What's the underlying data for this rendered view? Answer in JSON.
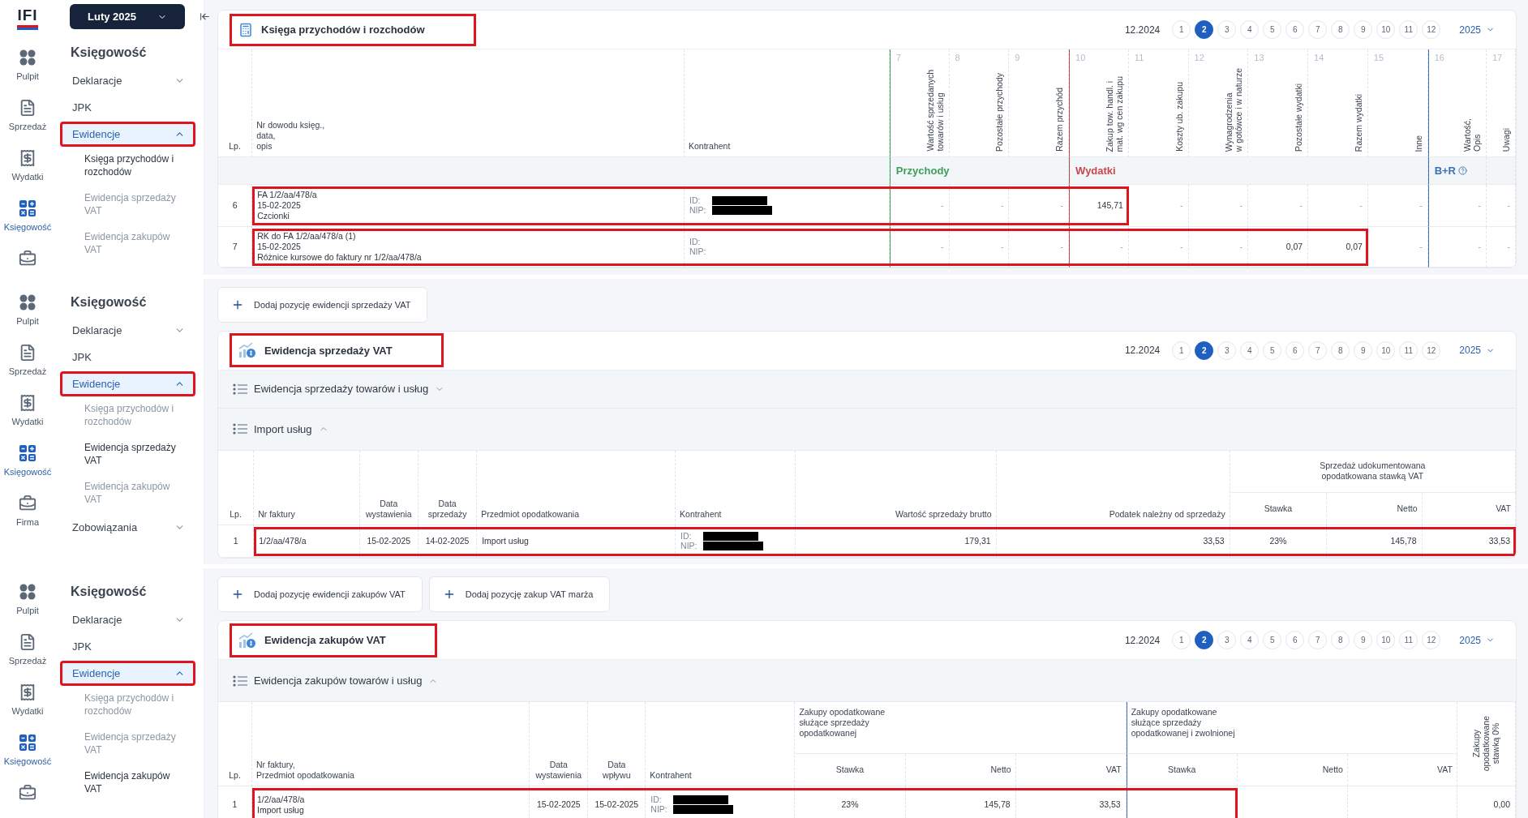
{
  "panels": [
    {
      "kind": "kpir",
      "logo": "IFI",
      "period_button": "Luty 2025",
      "rail": [
        {
          "kind": "dashboard",
          "label": "Pulpit",
          "selected": false
        },
        {
          "kind": "sales",
          "label": "Sprzedaż",
          "selected": false
        },
        {
          "kind": "expenses",
          "label": "Wydatki",
          "selected": false
        },
        {
          "kind": "accounting",
          "label": "Księgowość",
          "selected": true
        },
        {
          "kind": "company",
          "selected": false
        }
      ],
      "nav": {
        "heading": "Księgowość",
        "items": [
          {
            "label": "Deklaracje",
            "kind": "group",
            "expanded": false,
            "selected": false,
            "highlighted": false
          },
          {
            "label": "JPK",
            "kind": "link",
            "selected": false,
            "highlighted": false
          },
          {
            "label": "Ewidencje",
            "kind": "group",
            "expanded": true,
            "selected": true,
            "highlighted": true,
            "children": [
              {
                "label": "Księga przychodów i rozchodów",
                "selected": true
              },
              {
                "label": "Ewidencja sprzedaży VAT",
                "selected": false
              },
              {
                "label": "Ewidencja zakupów VAT",
                "selected": false
              }
            ]
          }
        ]
      },
      "card": {
        "title": "Księga przychodów i rozchodów",
        "title_highlighted": true,
        "pager": {
          "period": "12.2024",
          "months": [
            {
              "label": "1",
              "selected": false
            },
            {
              "label": "2",
              "selected": true
            },
            {
              "label": "3",
              "selected": false
            },
            {
              "label": "4",
              "selected": false
            },
            {
              "label": "5",
              "selected": false
            },
            {
              "label": "6",
              "selected": false
            },
            {
              "label": "7",
              "selected": false
            },
            {
              "label": "8",
              "selected": false
            },
            {
              "label": "9",
              "selected": false
            },
            {
              "label": "10",
              "selected": false
            },
            {
              "label": "11",
              "selected": false
            },
            {
              "label": "12",
              "selected": false
            }
          ],
          "year": "2025"
        },
        "table": {
          "kind": "kpir",
          "columns": [
            {
              "lines": [
                "Lp."
              ]
            },
            {
              "lines": [
                "Nr dowodu księg.,",
                "data,",
                "opis"
              ]
            },
            {
              "lines": [
                "Kontrahent"
              ]
            }
          ],
          "column_groups": [
            {
              "label": "Przychody",
              "color": "#3f9d5a",
              "columns": [
                {
                  "number": "7",
                  "lines": [
                    "Wartość sprzedanych",
                    "towarów i usług"
                  ]
                },
                {
                  "number": "8",
                  "lines": [
                    "Pozostałe przychody"
                  ]
                },
                {
                  "number": "9",
                  "lines": [
                    "Razem przychód"
                  ]
                }
              ]
            },
            {
              "label": "Wydatki",
              "color": "#c5484b",
              "columns": [
                {
                  "number": "10",
                  "lines": [
                    "Zakup tow. handl. i",
                    "mat. wg cen zakupu"
                  ]
                },
                {
                  "number": "11",
                  "lines": [
                    "Koszty ub. zakupu"
                  ]
                },
                {
                  "number": "12",
                  "lines": [
                    "Wynagrodzenia",
                    "w gotówce i w naturze"
                  ]
                },
                {
                  "number": "13",
                  "lines": [
                    "Pozostałe wydatki"
                  ]
                },
                {
                  "number": "14",
                  "lines": [
                    "Razem wydatki"
                  ]
                },
                {
                  "number": "15",
                  "lines": [
                    "Inne"
                  ]
                }
              ]
            },
            {
              "label": "B+R",
              "color": "#3b6fb6",
              "help": true,
              "columns": [
                {
                  "number": "16",
                  "lines": [
                    "Wartość,",
                    "Opis"
                  ]
                }
              ]
            },
            {
              "columns": [
                {
                  "number": "17",
                  "lines": [
                    "Uwagi"
                  ]
                }
              ]
            }
          ],
          "rows": [
            {
              "lead_cells": [
                {
                  "kind": "text",
                  "lines": [
                    "6"
                  ]
                }
              ],
              "framed_cells": [
                {
                  "kind": "text",
                  "lines": [
                    "FA 1/2/aa/478/a",
                    "15-02-2025",
                    "Czcionki"
                  ]
                },
                {
                  "kind": "contractor",
                  "id_label": "ID:",
                  "nip_label": "NIP:",
                  "redacted": true
                },
                {
                  "kind": "dash",
                  "lines": [
                    "-"
                  ]
                },
                {
                  "kind": "dash",
                  "lines": [
                    "-"
                  ]
                },
                {
                  "kind": "dash",
                  "lines": [
                    "-"
                  ]
                },
                {
                  "kind": "text",
                  "lines": [
                    "145,71"
                  ]
                }
              ],
              "trail_cells": [
                {
                  "kind": "dash",
                  "lines": [
                    "-"
                  ]
                },
                {
                  "kind": "dash",
                  "lines": [
                    "-"
                  ]
                },
                {
                  "kind": "dash",
                  "lines": [
                    "-"
                  ]
                },
                {
                  "kind": "dash",
                  "lines": [
                    "-"
                  ]
                },
                {
                  "kind": "dash",
                  "lines": [
                    "-"
                  ]
                },
                {
                  "kind": "dash",
                  "lines": [
                    "-"
                  ]
                },
                {
                  "kind": "dash",
                  "lines": [
                    "-"
                  ]
                }
              ]
            },
            {
              "lead_cells": [
                {
                  "kind": "text",
                  "lines": [
                    "7"
                  ]
                }
              ],
              "framed_cells": [
                {
                  "kind": "text",
                  "lines": [
                    "RK do FA 1/2/aa/478/a (1)",
                    "15-02-2025",
                    "Różnice kursowe do faktury nr 1/2/aa/478/a"
                  ]
                },
                {
                  "kind": "contractor",
                  "id_label": "ID:",
                  "nip_label": "NIP:",
                  "redacted": false
                },
                {
                  "kind": "dash",
                  "lines": [
                    "-"
                  ]
                },
                {
                  "kind": "dash",
                  "lines": [
                    "-"
                  ]
                },
                {
                  "kind": "dash",
                  "lines": [
                    "-"
                  ]
                },
                {
                  "kind": "dash",
                  "lines": [
                    "-"
                  ]
                },
                {
                  "kind": "dash",
                  "lines": [
                    "-"
                  ]
                },
                {
                  "kind": "dash",
                  "lines": [
                    "-"
                  ]
                },
                {
                  "kind": "text",
                  "lines": [
                    "0,07"
                  ]
                },
                {
                  "kind": "text",
                  "lines": [
                    "0,07"
                  ]
                }
              ],
              "trail_cells": [
                {
                  "kind": "dash",
                  "lines": [
                    "-"
                  ]
                },
                {
                  "kind": "dash",
                  "lines": [
                    "-"
                  ]
                },
                {
                  "kind": "dash",
                  "lines": [
                    "-"
                  ]
                }
              ]
            }
          ]
        }
      }
    },
    {
      "kind": "sales",
      "rail": [
        {
          "kind": "dashboard",
          "label": "Pulpit",
          "selected": false
        },
        {
          "kind": "sales",
          "label": "Sprzedaż",
          "selected": false
        },
        {
          "kind": "expenses",
          "label": "Wydatki",
          "selected": false
        },
        {
          "kind": "accounting",
          "label": "Księgowość",
          "selected": true
        },
        {
          "kind": "company",
          "label": "Firma",
          "selected": false
        }
      ],
      "nav": {
        "heading": "Księgowość",
        "items": [
          {
            "label": "Deklaracje",
            "kind": "group",
            "expanded": false,
            "selected": false,
            "highlighted": false
          },
          {
            "label": "JPK",
            "kind": "link",
            "selected": false,
            "highlighted": false
          },
          {
            "label": "Ewidencje",
            "kind": "group",
            "expanded": true,
            "selected": true,
            "highlighted": true,
            "children": [
              {
                "label": "Księga przychodów i rozchodów",
                "selected": false
              },
              {
                "label": "Ewidencja sprzedaży VAT",
                "selected": true
              },
              {
                "label": "Ewidencja zakupów VAT",
                "selected": false
              }
            ]
          },
          {
            "label": "Zobowiązania",
            "kind": "group",
            "expanded": false,
            "selected": false,
            "highlighted": false
          }
        ]
      },
      "actions": [
        {
          "label": "Dodaj pozycję ewidencji sprzedaży VAT"
        }
      ],
      "card": {
        "title": "Ewidencja sprzedaży VAT",
        "title_highlighted": true,
        "pager": {
          "period": "12.2024",
          "months": [
            {
              "label": "1",
              "selected": false
            },
            {
              "label": "2",
              "selected": true
            },
            {
              "label": "3",
              "selected": false
            },
            {
              "label": "4",
              "selected": false
            },
            {
              "label": "5",
              "selected": false
            },
            {
              "label": "6",
              "selected": false
            },
            {
              "label": "7",
              "selected": false
            },
            {
              "label": "8",
              "selected": false
            },
            {
              "label": "9",
              "selected": false
            },
            {
              "label": "10",
              "selected": false
            },
            {
              "label": "11",
              "selected": false
            },
            {
              "label": "12",
              "selected": false
            }
          ],
          "year": "2025"
        },
        "sections": [
          {
            "label": "Ewidencja sprzedaży towarów i usług",
            "expanded": false
          },
          {
            "label": "Import usług",
            "expanded": true
          }
        ],
        "table": {
          "kind": "sales",
          "header": [
            {
              "kind": "column",
              "lines": [
                "Lp."
              ]
            },
            {
              "kind": "column",
              "lines": [
                "Nr faktury"
              ]
            },
            {
              "kind": "column",
              "lines": [
                "Data",
                "wystawienia"
              ]
            },
            {
              "kind": "column",
              "lines": [
                "Data",
                "sprzedaży"
              ]
            },
            {
              "kind": "column",
              "lines": [
                "Przedmiot opodatkowania"
              ]
            },
            {
              "kind": "column",
              "lines": [
                "Kontrahent"
              ]
            },
            {
              "kind": "column",
              "lines": [
                "Wartość sprzedaży brutto"
              ]
            },
            {
              "kind": "column",
              "lines": [
                "Podatek należny od sprzedaży"
              ]
            },
            {
              "kind": "group",
              "lines": [
                "Sprzedaż udokumentowana",
                "opodatkowana stawką VAT"
              ],
              "columns": [
                {
                  "lines": [
                    "Stawka"
                  ]
                },
                {
                  "lines": [
                    "Netto"
                  ]
                },
                {
                  "lines": [
                    "VAT"
                  ]
                }
              ]
            }
          ],
          "rows": [
            {
              "lead_cells": [
                {
                  "kind": "text",
                  "lines": [
                    "1"
                  ]
                }
              ],
              "framed_cells": [
                {
                  "kind": "text",
                  "lines": [
                    "1/2/aa/478/a"
                  ]
                },
                {
                  "kind": "text",
                  "lines": [
                    "15-02-2025"
                  ]
                },
                {
                  "kind": "text",
                  "lines": [
                    "14-02-2025"
                  ]
                },
                {
                  "kind": "text",
                  "lines": [
                    "Import usług"
                  ]
                },
                {
                  "kind": "contractor",
                  "id_label": "ID:",
                  "nip_label": "NIP:",
                  "redacted": true
                },
                {
                  "kind": "text",
                  "lines": [
                    "179,31"
                  ]
                },
                {
                  "kind": "text",
                  "lines": [
                    "33,53"
                  ]
                },
                {
                  "kind": "text",
                  "lines": [
                    "23%"
                  ]
                },
                {
                  "kind": "text",
                  "lines": [
                    "145,78"
                  ]
                },
                {
                  "kind": "text",
                  "lines": [
                    "33,53"
                  ]
                }
              ]
            }
          ]
        }
      }
    },
    {
      "kind": "purchases",
      "rail": [
        {
          "kind": "dashboard",
          "label": "Pulpit",
          "selected": false
        },
        {
          "kind": "sales",
          "label": "Sprzedaż",
          "selected": false
        },
        {
          "kind": "expenses",
          "label": "Wydatki",
          "selected": false
        },
        {
          "kind": "accounting",
          "label": "Księgowość",
          "selected": true
        },
        {
          "kind": "company",
          "selected": false
        }
      ],
      "nav": {
        "heading": "Księgowość",
        "items": [
          {
            "label": "Deklaracje",
            "kind": "group",
            "expanded": false,
            "selected": false,
            "highlighted": false
          },
          {
            "label": "JPK",
            "kind": "link",
            "selected": false,
            "highlighted": false
          },
          {
            "label": "Ewidencje",
            "kind": "group",
            "expanded": true,
            "selected": true,
            "highlighted": true,
            "children": [
              {
                "label": "Księga przychodów i rozchodów",
                "selected": false
              },
              {
                "label": "Ewidencja sprzedaży VAT",
                "selected": false
              },
              {
                "label": "Ewidencja zakupów VAT",
                "selected": true
              }
            ]
          }
        ]
      },
      "actions": [
        {
          "label": "Dodaj pozycję ewidencji zakupów VAT"
        },
        {
          "label": "Dodaj pozycję zakup VAT marża"
        }
      ],
      "card": {
        "title": "Ewidencja zakupów VAT",
        "title_highlighted": true,
        "pager": {
          "period": "12.2024",
          "months": [
            {
              "label": "1",
              "selected": false
            },
            {
              "label": "2",
              "selected": true
            },
            {
              "label": "3",
              "selected": false
            },
            {
              "label": "4",
              "selected": false
            },
            {
              "label": "5",
              "selected": false
            },
            {
              "label": "6",
              "selected": false
            },
            {
              "label": "7",
              "selected": false
            },
            {
              "label": "8",
              "selected": false
            },
            {
              "label": "9",
              "selected": false
            },
            {
              "label": "10",
              "selected": false
            },
            {
              "label": "11",
              "selected": false
            },
            {
              "label": "12",
              "selected": false
            }
          ],
          "year": "2025"
        },
        "sections": [
          {
            "label": "Ewidencja zakupów towarów i usług",
            "expanded": true
          }
        ],
        "table": {
          "kind": "purchases",
          "header": [
            {
              "kind": "column",
              "lines": [
                "Lp."
              ]
            },
            {
              "kind": "column",
              "lines": [
                "Nr faktury,",
                "Przedmiot opodatkowania"
              ]
            },
            {
              "kind": "column",
              "lines": [
                "Data",
                "wystawienia"
              ]
            },
            {
              "kind": "column",
              "lines": [
                "Data",
                "wpływu"
              ]
            },
            {
              "kind": "column",
              "lines": [
                "Kontrahent"
              ]
            },
            {
              "kind": "group",
              "lines": [
                "Zakupy opodatkowane",
                "służące sprzedaży",
                "opodatkowanej"
              ],
              "columns": [
                {
                  "lines": [
                    "Stawka"
                  ]
                },
                {
                  "lines": [
                    "Netto"
                  ]
                },
                {
                  "lines": [
                    "VAT"
                  ]
                }
              ]
            },
            {
              "kind": "group",
              "lines": [
                "Zakupy opodatkowane",
                "służące sprzedaży",
                "opodatkowanej i zwolnionej"
              ],
              "columns": [
                {
                  "lines": [
                    "Stawka"
                  ]
                },
                {
                  "lines": [
                    "Netto"
                  ]
                },
                {
                  "lines": [
                    "VAT"
                  ]
                }
              ]
            },
            {
              "kind": "rotated-column",
              "lines": [
                "Zakupy",
                "opodatkowane",
                "stawką 0%"
              ]
            }
          ],
          "rows": [
            {
              "lead_cells": [
                {
                  "kind": "text",
                  "lines": [
                    "1"
                  ]
                }
              ],
              "framed_cells": [
                {
                  "kind": "text",
                  "lines": [
                    "1/2/aa/478/a",
                    "Import usług"
                  ]
                },
                {
                  "kind": "text",
                  "lines": [
                    "15-02-2025"
                  ]
                },
                {
                  "kind": "text",
                  "lines": [
                    "15-02-2025"
                  ]
                },
                {
                  "kind": "contractor",
                  "id_label": "ID:",
                  "nip_label": "NIP:",
                  "redacted": true
                },
                {
                  "kind": "text",
                  "lines": [
                    "23%"
                  ]
                },
                {
                  "kind": "text",
                  "lines": [
                    "145,78"
                  ]
                },
                {
                  "kind": "text",
                  "lines": [
                    "33,53"
                  ]
                },
                {
                  "kind": "empty"
                }
              ],
              "trail_cells": [
                {
                  "kind": "empty"
                },
                {
                  "kind": "empty"
                },
                {
                  "kind": "text",
                  "lines": [
                    "0,00"
                  ]
                }
              ]
            }
          ]
        }
      }
    }
  ]
}
